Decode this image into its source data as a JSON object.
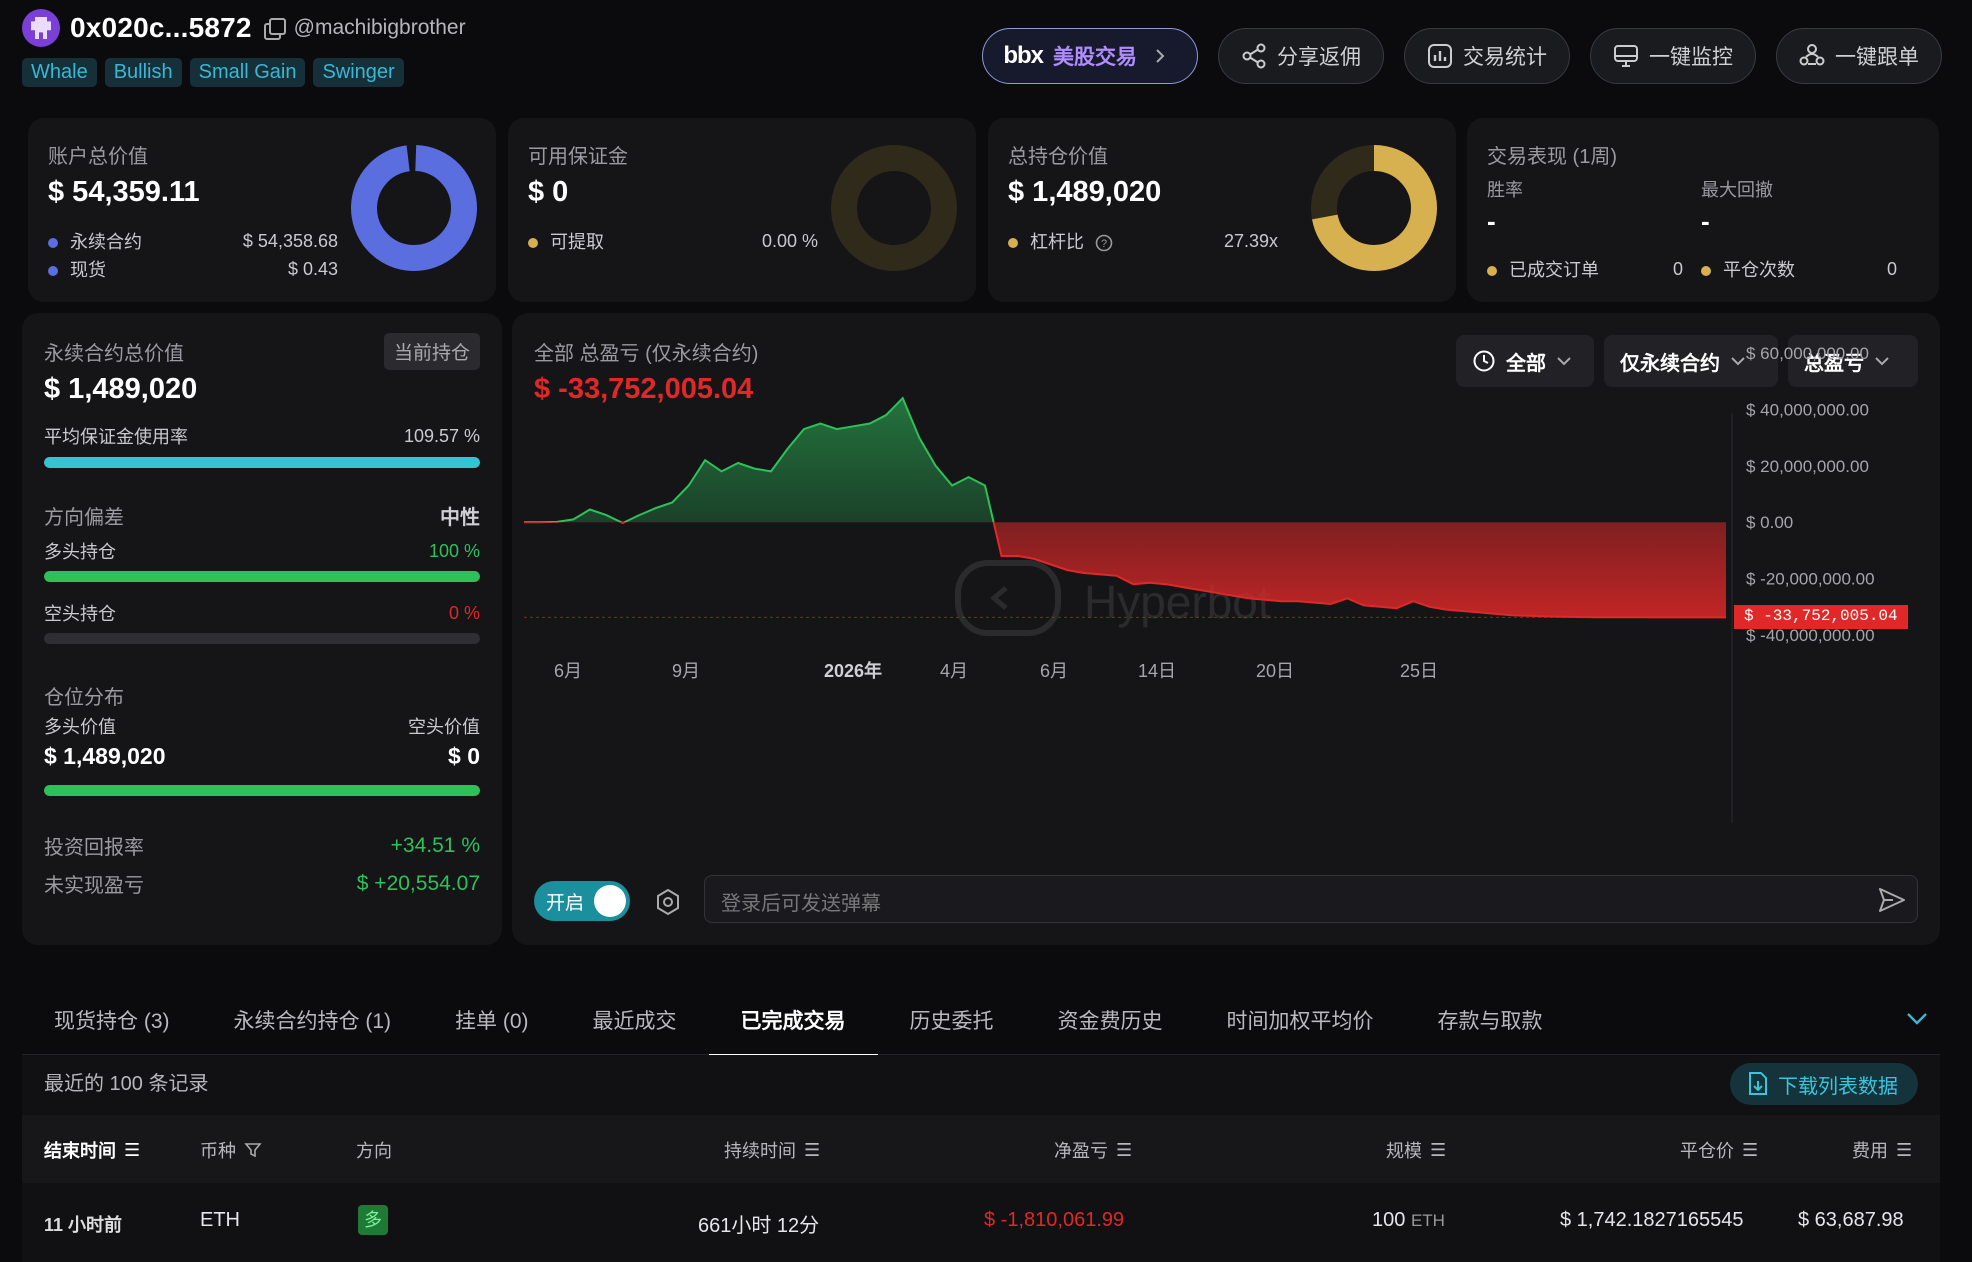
{
  "header": {
    "address": "0x020c...5872",
    "handle": "@machibigbrother",
    "tags": [
      "Whale",
      "Bullish",
      "Small Gain",
      "Swinger"
    ]
  },
  "top_buttons": {
    "stock_logo": "bbx",
    "stock_label": "美股交易",
    "share": "分享返佣",
    "stats": "交易统计",
    "monitor": "一键监控",
    "copy_trade": "一键跟单"
  },
  "account": {
    "title": "账户总价值",
    "value": "$ 54,359.11",
    "perp_label": "永续合约",
    "perp_value": "$ 54,358.68",
    "spot_label": "现货",
    "spot_value": "$ 0.43",
    "perp_share": 0.99999
  },
  "margin": {
    "title": "可用保证金",
    "value": "$ 0",
    "withdraw_label": "可提取",
    "withdraw_value": "0.00 %",
    "ratio": 0
  },
  "position": {
    "title": "总持仓价值",
    "value": "$ 1,489,020",
    "lev_label": "杠杆比",
    "lev_value": "27.39x",
    "gauge_fraction": 0.72
  },
  "performance": {
    "title": "交易表现 (1周)",
    "win_label": "胜率",
    "win_value": "-",
    "dd_label": "最大回撤",
    "dd_value": "-",
    "orders_label": "已成交订单",
    "orders_value": "0",
    "close_label": "平仓次数",
    "close_value": "0"
  },
  "perp_panel": {
    "title": "永续合约总价值",
    "badge": "当前持仓",
    "value": "$ 1,489,020",
    "margin_use_label": "平均保证金使用率",
    "margin_use_value": "109.57 %",
    "margin_use_fill": 1.0,
    "bias_label": "方向偏差",
    "bias_value": "中性",
    "long_label": "多头持仓",
    "long_value": "100 %",
    "long_fill": 1.0,
    "short_label": "空头持仓",
    "short_value": "0 %",
    "short_fill": 0,
    "dist_label": "仓位分布",
    "long_val_label": "多头价值",
    "short_val_label": "空头价值",
    "long_val": "$ 1,489,020",
    "short_val": "$ 0",
    "dist_fill": 1.0,
    "roi_label": "投资回报率",
    "roi_value": "+34.51 %",
    "upnl_label": "未实现盈亏",
    "upnl_value": "$ +20,554.07"
  },
  "pnl": {
    "title": "全部 总盈亏 (仅永续合约)",
    "value": "$ -33,752,005.04",
    "filter_time": "全部",
    "filter_type": "仅永续合约",
    "filter_metric": "总盈亏",
    "watermark": "Hyperbot",
    "current_tag": "$ -33,752,005.04",
    "danmaku_toggle": "开启",
    "danmaku_placeholder": "登录后可发送弹幕"
  },
  "chart_data": {
    "type": "area",
    "y_ticks": [
      "$ 60,000,000.00",
      "$ 40,000,000.00",
      "$ 20,000,000.00",
      "$ 0.00",
      "$ -20,000,000.00",
      "$ -40,000,000.00"
    ],
    "ylim": [
      -40000000,
      60000000
    ],
    "x_ticks": [
      "6月",
      "9月",
      "2026年",
      "4月",
      "6月",
      "14日",
      "20日",
      "25日"
    ],
    "series": [
      {
        "values": [
          0,
          0,
          100000,
          1000000,
          4500000,
          2500000,
          -300000,
          2500000,
          5000000,
          7000000,
          13000000,
          22000000,
          18000000,
          21000000,
          19000000,
          18000000,
          26000000,
          33000000,
          35000000,
          33000000,
          34000000,
          35000000,
          38000000,
          44000000,
          30000000,
          20000000,
          13000000,
          16000000,
          13000000,
          -12000000,
          -12000000,
          -13000000,
          -15000000,
          -17000000,
          -18000000,
          -18500000,
          -19000000,
          -22000000,
          -21500000,
          -22000000,
          -23000000,
          -24000000,
          -25000000,
          -26000000,
          -27000000,
          -27500000,
          -28000000,
          -28000000,
          -28500000,
          -29000000,
          -27000000,
          -29500000,
          -30000000,
          -30500000,
          -28000000,
          -30000000,
          -31000000,
          -31500000,
          -32000000,
          -32500000,
          -33000000,
          -33200000,
          -33400000,
          -33500000,
          -33600000,
          -33700000,
          -33720000,
          -33730000,
          -33740000,
          -33745000,
          -33748000,
          -33750000,
          -33751000,
          -33752005
        ]
      }
    ],
    "current_value": -33752005.04
  },
  "tabs": [
    "现货持仓 (3)",
    "永续合约持仓 (1)",
    "挂单 (0)",
    "最近成交",
    "已完成交易",
    "历史委托",
    "资金费历史",
    "时间加权平均价",
    "存款与取款"
  ],
  "table": {
    "caption": "最近的 100 条记录",
    "download": "下载列表数据",
    "headers": [
      "结束时间",
      "币种",
      "方向",
      "持续时间",
      "净盈亏",
      "规模",
      "平仓价",
      "费用"
    ],
    "rows": [
      {
        "time": "11 小时前",
        "coin": "ETH",
        "side": "多",
        "duration": "661小时 12分",
        "pnl": "$ -1,810,061.99",
        "size": "100",
        "size_unit": "ETH",
        "close_price": "$ 1,742.1827165545",
        "fee": "$ 63,687.98"
      }
    ]
  },
  "colors": {
    "accent_blue": "#5a6ee0",
    "gold": "#d7b04f",
    "teal": "#35c4d4",
    "green": "#2ec15a",
    "red": "#e02828"
  }
}
